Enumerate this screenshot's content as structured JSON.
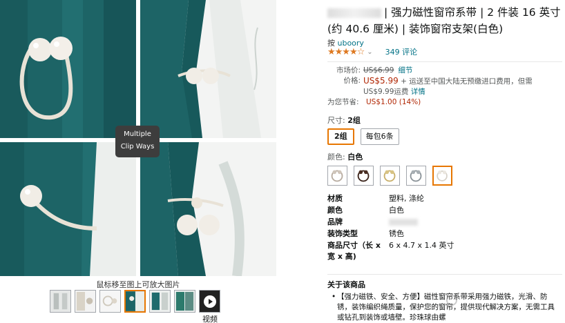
{
  "gallery": {
    "badge_line1": "Multiple",
    "badge_line2": "Clip Ways",
    "zoom_hint": "鼠标移至图上可放大图片",
    "video_label": "视频"
  },
  "product": {
    "title": "| 强力磁性窗帘系带 | 2 件装 16 英寸(约 40.6 厘米) | 装饰窗帘支架(白色)",
    "by_prefix": "按",
    "brand": "uboory",
    "stars": "★★★★☆",
    "rating_count": "349 评论"
  },
  "price": {
    "list_label": "市场价:",
    "list_price": "US$6.99",
    "list_link": "细节",
    "price_label": "价格:",
    "price": "US$5.99",
    "shipping_text": "+ 运送至中国大陆无预缴进口费用，但需 US$9.99运费",
    "shipping_link": "详情",
    "save_label": "为您节省:",
    "save_value": "US$1.00 (14%)"
  },
  "size": {
    "label": "尺寸:",
    "selected": "2组",
    "options": [
      "2组",
      "每包6条"
    ]
  },
  "color": {
    "label": "颜色:",
    "selected": "白色",
    "swatches": [
      "greige",
      "brown",
      "gold",
      "silver-gray",
      "white"
    ]
  },
  "specs": [
    {
      "key": "材质",
      "value": "塑料, 涤纶"
    },
    {
      "key": "颜色",
      "value": "白色"
    },
    {
      "key": "品牌",
      "value": ""
    },
    {
      "key": "装饰类型",
      "value": "锈色"
    },
    {
      "key": "商品尺寸（长 x 宽 x 高)",
      "value": "6 x 4.7 x 1.4 英寸"
    }
  ],
  "about": {
    "title": "关于该商品",
    "bullet": "【强力磁铁、安全、方便】磁性窗帘系带采用强力磁铁，光滑、防锈，装饰编织绳质量，保护您的窗帘，提供现代解决方案，无需工具或钻孔到装饰或墙壁。珍珠球由螺"
  },
  "colors": {
    "teal_curtain": "#1f6b6d",
    "link": "#007185",
    "price_red": "#b12704",
    "star": "#de7921",
    "selected_border": "#e77600"
  }
}
